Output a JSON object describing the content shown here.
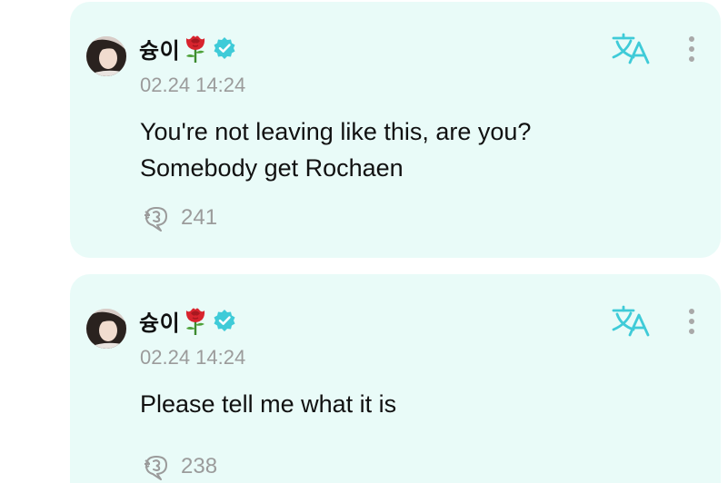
{
  "posts": [
    {
      "author": "슝이",
      "timestamp": "02.24 14:24",
      "text_lines": [
        "You're not leaving like this, are you?",
        "Somebody get Rochaen"
      ],
      "comment_count": "241"
    },
    {
      "author": "슝이",
      "timestamp": "02.24 14:24",
      "text_lines": [
        "Please tell me what it is"
      ],
      "comment_count": "238"
    }
  ],
  "icons": {
    "avatar": "profile-photo",
    "author_emoji": "rose-icon",
    "verified": "verified-badge-icon",
    "translate": "translate-icon",
    "more": "more-vertical-icon",
    "comments": "comment-icon"
  },
  "colors": {
    "card_background": "#e9fbf8",
    "accent": "#3fcbd8",
    "muted_text": "#9b9b9b",
    "primary_text": "#111111"
  }
}
